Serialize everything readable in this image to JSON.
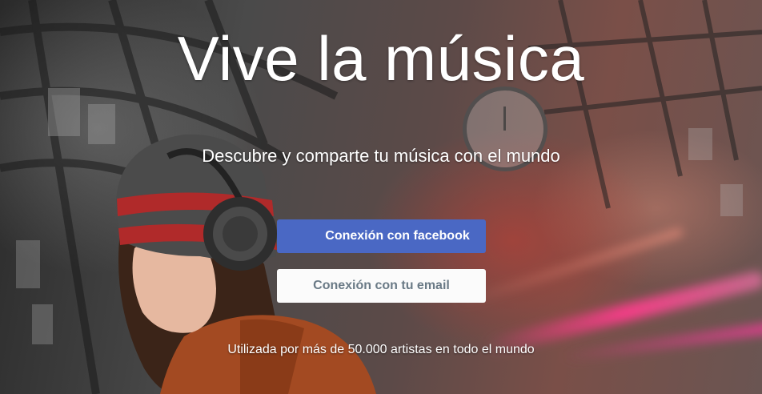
{
  "hero": {
    "headline": "Vive la música",
    "subheadline": "Descubre y comparte tu música con el mundo"
  },
  "actions": {
    "facebook_label": "Conexión con facebook",
    "email_label": "Conexión con tu email"
  },
  "footer": {
    "note": "Utilizada por más de 50.000 artistas en todo el mundo"
  },
  "colors": {
    "facebook_button": "#4a68c4",
    "email_button": "#fbfbfb",
    "email_button_text": "#6a7a86",
    "text": "#ffffff"
  },
  "imagery": {
    "background": "train-station-photo",
    "subject": "woman-with-headphones-and-striped-beanie"
  }
}
